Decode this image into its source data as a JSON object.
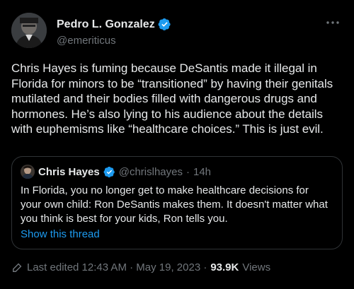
{
  "author": {
    "display_name": "Pedro L. Gonzalez",
    "handle": "@emeriticus",
    "verified_color": "#1d9bf0"
  },
  "more_icon": "more-dots-icon",
  "tweet": {
    "text": "Chris Hayes is fuming because DeSantis made it illegal in Florida for minors to be “transitioned” by having their genitals mutilated and their bodies filled with dangerous drugs and hormones. He’s also lying to his audience about the details with euphemisms like “healthcare choices.” This is just evil."
  },
  "quoted_tweet": {
    "display_name": "Chris Hayes",
    "handle": "@chrislhayes",
    "separator": "·",
    "time": "14h",
    "text": "In Florida, you no longer get to make healthcare decisions for your own child: Ron DeSantis makes them. It doesn't matter what you think is best for your kids, Ron tells you.",
    "show_thread": "Show this thread"
  },
  "meta": {
    "edited_label": "Last edited 12:43 AM · May 19, 2023 ·",
    "views_count": "93.9K",
    "views_label": "Views"
  },
  "colors": {
    "background": "#000000",
    "text_primary": "#e7e9ea",
    "text_secondary": "#71767b",
    "accent": "#1d9bf0",
    "border": "#2f3336"
  }
}
